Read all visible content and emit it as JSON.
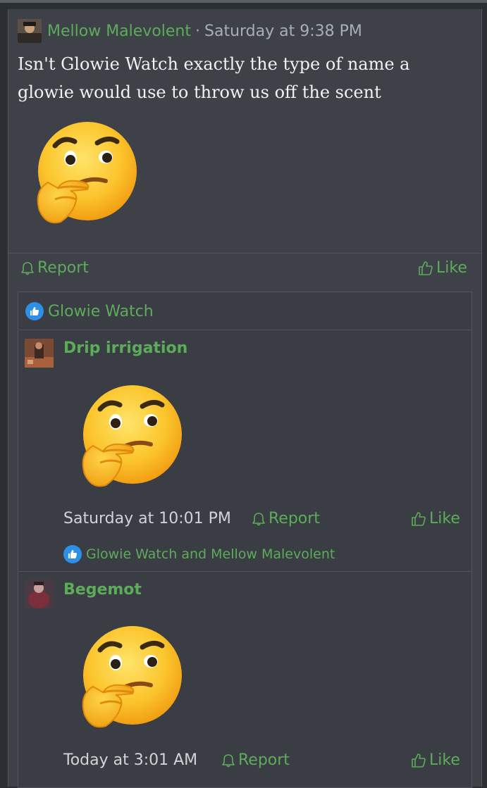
{
  "post": {
    "author": "Mellow Malevolent",
    "separator": "·",
    "timestamp": "Saturday at 9:38 PM",
    "text": "Isn't Glowie Watch exactly the type of name a glowie would use to throw us off the scent",
    "emoji": "thinking-face",
    "report_label": "Report",
    "like_label": "Like",
    "liked_by": "Glowie Watch"
  },
  "comments": [
    {
      "author": "Drip irrigation",
      "emoji": "thinking-face",
      "timestamp": "Saturday at 10:01 PM",
      "report_label": "Report",
      "like_label": "Like",
      "liked_by": "Glowie Watch and Mellow Malevolent"
    },
    {
      "author": "Begemot",
      "emoji": "thinking-face",
      "timestamp": "Today at 3:01 AM",
      "report_label": "Report",
      "like_label": "Like"
    }
  ],
  "colors": {
    "accent": "#5cac5a",
    "background": "#3e4148",
    "like_badge": "#2e8fe6"
  }
}
